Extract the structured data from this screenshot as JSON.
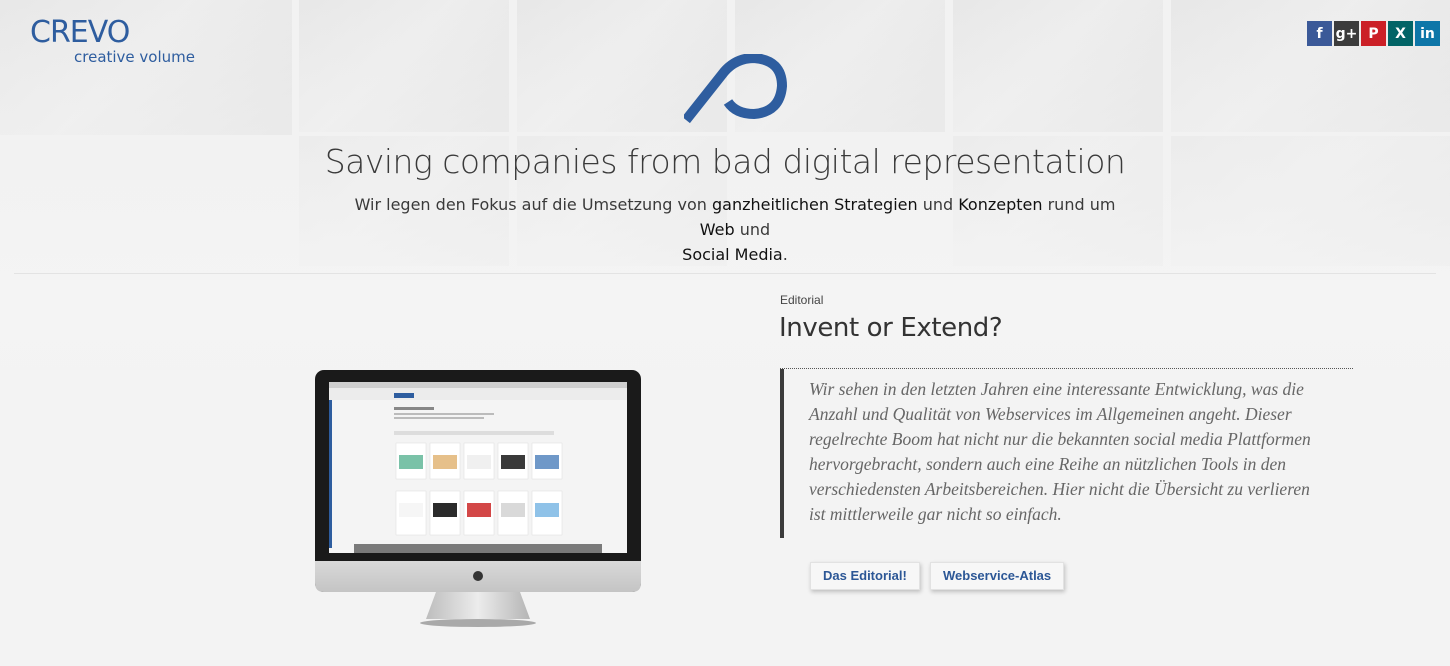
{
  "brand": {
    "name": "CREVO",
    "tagline": "creative volume",
    "color": "#2e5d9f"
  },
  "social": [
    {
      "name": "facebook-icon",
      "glyph": "f",
      "color": "#3b5998"
    },
    {
      "name": "google-plus-icon",
      "glyph": "g+",
      "color": "#3c3c3c"
    },
    {
      "name": "pinterest-icon",
      "glyph": "P",
      "color": "#cb2027"
    },
    {
      "name": "xing-icon",
      "glyph": "X",
      "color": "#026466"
    },
    {
      "name": "linkedin-icon",
      "glyph": "in",
      "color": "#0e76a8"
    }
  ],
  "hero": {
    "title": "Saving companies from bad digital representation",
    "sub_1": "Wir legen den Fokus auf die Umsetzung von ",
    "bold_strategies": "ganzheitlichen Strategien",
    "sub_and_1": " und ",
    "bold_concepts": "Konzepten",
    "sub_around": " rund um ",
    "bold_web": "Web",
    "sub_and_2": " und ",
    "bold_social": "Social Media",
    "sub_end": "."
  },
  "editorial": {
    "kicker": "Editorial",
    "headline": "Invent or Extend?",
    "quote": "Wir sehen in den letzten Jahren eine interessante Entwicklung, was die Anzahl und Qualität von Webservices im Allgemeinen angeht. Dieser regelrechte Boom hat nicht nur die bekannten social media Plattformen hervorgebracht, sondern auch eine Reihe an nützlichen Tools in den verschiedensten Arbeitsbereichen. Hier nicht die Übersicht zu verlieren ist mittlerweile gar nicht so einfach.",
    "buttons": {
      "editorial": "Das Editorial!",
      "atlas": "Webservice-Atlas"
    }
  }
}
